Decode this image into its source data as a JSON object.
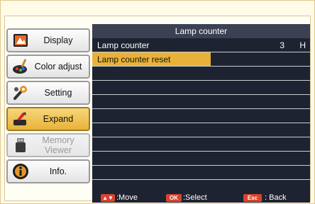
{
  "sidebar": {
    "items": [
      {
        "label": "Display"
      },
      {
        "label": "Color adjust"
      },
      {
        "label": "Setting"
      },
      {
        "label": "Expand"
      },
      {
        "label": "Memory Viewer"
      },
      {
        "label": "Info."
      }
    ]
  },
  "panel": {
    "title": "Lamp counter",
    "rows": [
      {
        "label": "Lamp counter",
        "value": "3",
        "unit": "H"
      },
      {
        "label": "Lamp counter reset"
      }
    ]
  },
  "footer": {
    "move_key": "▲▼",
    "move_label": ":Move",
    "select_key": "OK",
    "select_label": ":Select",
    "back_key": "Esc",
    "back_label": ": Back"
  },
  "colors": {
    "highlight": "#e8b23a",
    "panel_bg": "#1d2331",
    "key_red": "#d9442e"
  }
}
